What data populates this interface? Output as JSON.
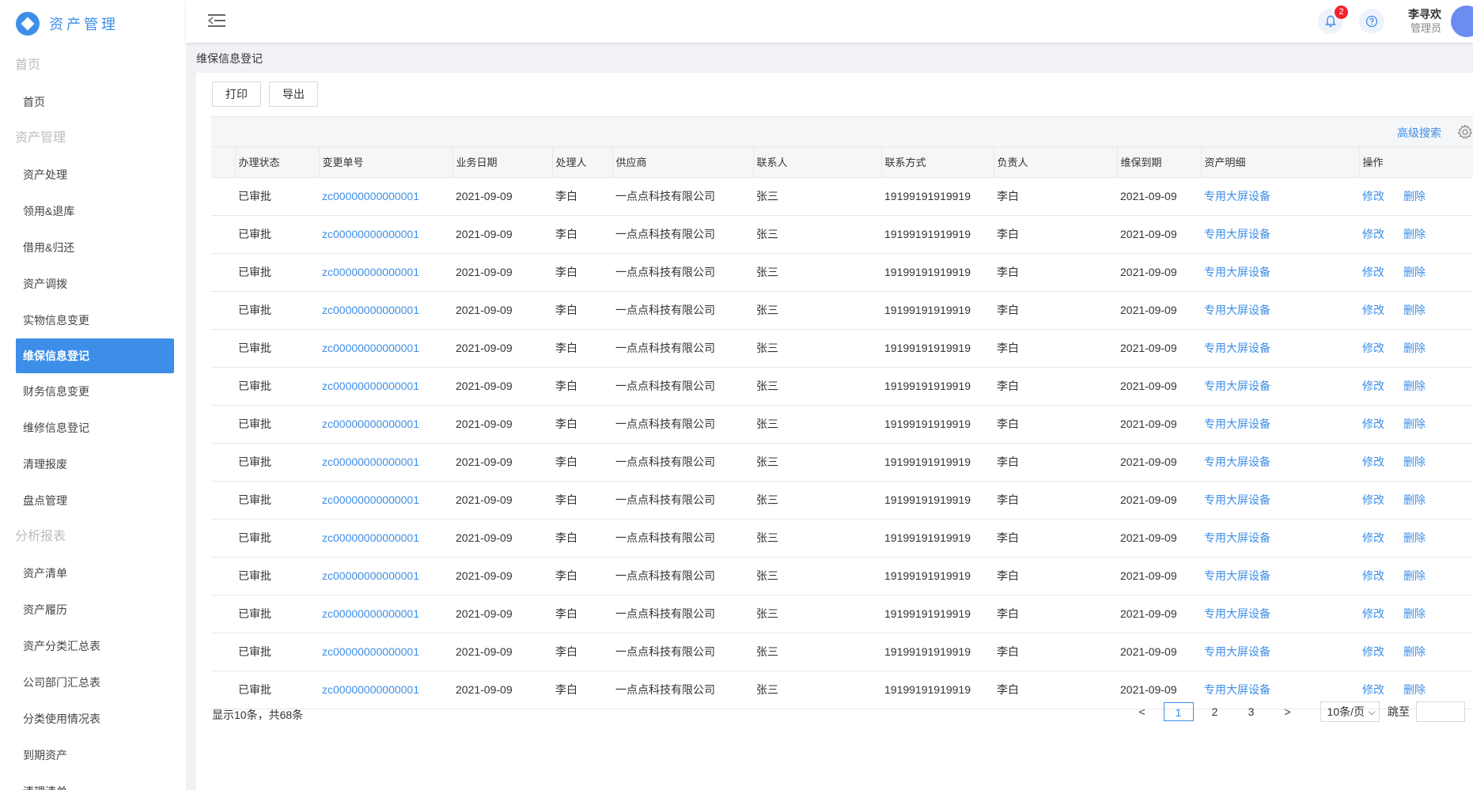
{
  "app": {
    "title": "资产管理"
  },
  "sidebar": {
    "groups": [
      {
        "label": "首页",
        "items": [
          "首页"
        ]
      },
      {
        "label": "资产管理",
        "items": [
          "资产处理",
          "领用&退库",
          "借用&归还",
          "资产调拨",
          "实物信息变更",
          "维保信息登记",
          "财务信息变更",
          "维修信息登记",
          "清理报废",
          "盘点管理"
        ]
      },
      {
        "label": "分析报表",
        "items": [
          "资产清单",
          "资产履历",
          "资产分类汇总表",
          "公司部门汇总表",
          "分类使用情况表",
          "到期资产",
          "清理清单"
        ]
      }
    ],
    "active": "维保信息登记"
  },
  "header": {
    "notifications": "2",
    "user_name": "李寻欢",
    "user_role": "管理员"
  },
  "breadcrumb": "维保信息登记",
  "toolbar": {
    "print_label": "打印",
    "export_label": "导出"
  },
  "table": {
    "advanced_search": "高级搜索",
    "columns": [
      "办理状态",
      "变更单号",
      "业务日期",
      "处理人",
      "供应商",
      "联系人",
      "联系方式",
      "负责人",
      "维保到期",
      "资产明细",
      "操作"
    ],
    "edit_label": "修改",
    "delete_label": "删除",
    "rows": [
      [
        "已审批",
        "zc00000000000001",
        "2021-09-09",
        "李白",
        "一点点科技有限公司",
        "张三",
        "19199191919919",
        "李白",
        "2021-09-09",
        "专用大屏设备"
      ],
      [
        "已审批",
        "zc00000000000001",
        "2021-09-09",
        "李白",
        "一点点科技有限公司",
        "张三",
        "19199191919919",
        "李白",
        "2021-09-09",
        "专用大屏设备"
      ],
      [
        "已审批",
        "zc00000000000001",
        "2021-09-09",
        "李白",
        "一点点科技有限公司",
        "张三",
        "19199191919919",
        "李白",
        "2021-09-09",
        "专用大屏设备"
      ],
      [
        "已审批",
        "zc00000000000001",
        "2021-09-09",
        "李白",
        "一点点科技有限公司",
        "张三",
        "19199191919919",
        "李白",
        "2021-09-09",
        "专用大屏设备"
      ],
      [
        "已审批",
        "zc00000000000001",
        "2021-09-09",
        "李白",
        "一点点科技有限公司",
        "张三",
        "19199191919919",
        "李白",
        "2021-09-09",
        "专用大屏设备"
      ],
      [
        "已审批",
        "zc00000000000001",
        "2021-09-09",
        "李白",
        "一点点科技有限公司",
        "张三",
        "19199191919919",
        "李白",
        "2021-09-09",
        "专用大屏设备"
      ],
      [
        "已审批",
        "zc00000000000001",
        "2021-09-09",
        "李白",
        "一点点科技有限公司",
        "张三",
        "19199191919919",
        "李白",
        "2021-09-09",
        "专用大屏设备"
      ],
      [
        "已审批",
        "zc00000000000001",
        "2021-09-09",
        "李白",
        "一点点科技有限公司",
        "张三",
        "19199191919919",
        "李白",
        "2021-09-09",
        "专用大屏设备"
      ],
      [
        "已审批",
        "zc00000000000001",
        "2021-09-09",
        "李白",
        "一点点科技有限公司",
        "张三",
        "19199191919919",
        "李白",
        "2021-09-09",
        "专用大屏设备"
      ],
      [
        "已审批",
        "zc00000000000001",
        "2021-09-09",
        "李白",
        "一点点科技有限公司",
        "张三",
        "19199191919919",
        "李白",
        "2021-09-09",
        "专用大屏设备"
      ],
      [
        "已审批",
        "zc00000000000001",
        "2021-09-09",
        "李白",
        "一点点科技有限公司",
        "张三",
        "19199191919919",
        "李白",
        "2021-09-09",
        "专用大屏设备"
      ],
      [
        "已审批",
        "zc00000000000001",
        "2021-09-09",
        "李白",
        "一点点科技有限公司",
        "张三",
        "19199191919919",
        "李白",
        "2021-09-09",
        "专用大屏设备"
      ],
      [
        "已审批",
        "zc00000000000001",
        "2021-09-09",
        "李白",
        "一点点科技有限公司",
        "张三",
        "19199191919919",
        "李白",
        "2021-09-09",
        "专用大屏设备"
      ],
      [
        "已审批",
        "zc00000000000001",
        "2021-09-09",
        "李白",
        "一点点科技有限公司",
        "张三",
        "19199191919919",
        "李白",
        "2021-09-09",
        "专用大屏设备"
      ]
    ]
  },
  "pagination": {
    "summary": "显示10条，共68条",
    "prev": "<",
    "next": ">",
    "pages": [
      "1",
      "2",
      "3"
    ],
    "current": "1",
    "page_size": "10条/页",
    "jump_label": "跳至"
  },
  "colors": {
    "accent": "#3d8ee8",
    "badge": "#f5222d"
  }
}
